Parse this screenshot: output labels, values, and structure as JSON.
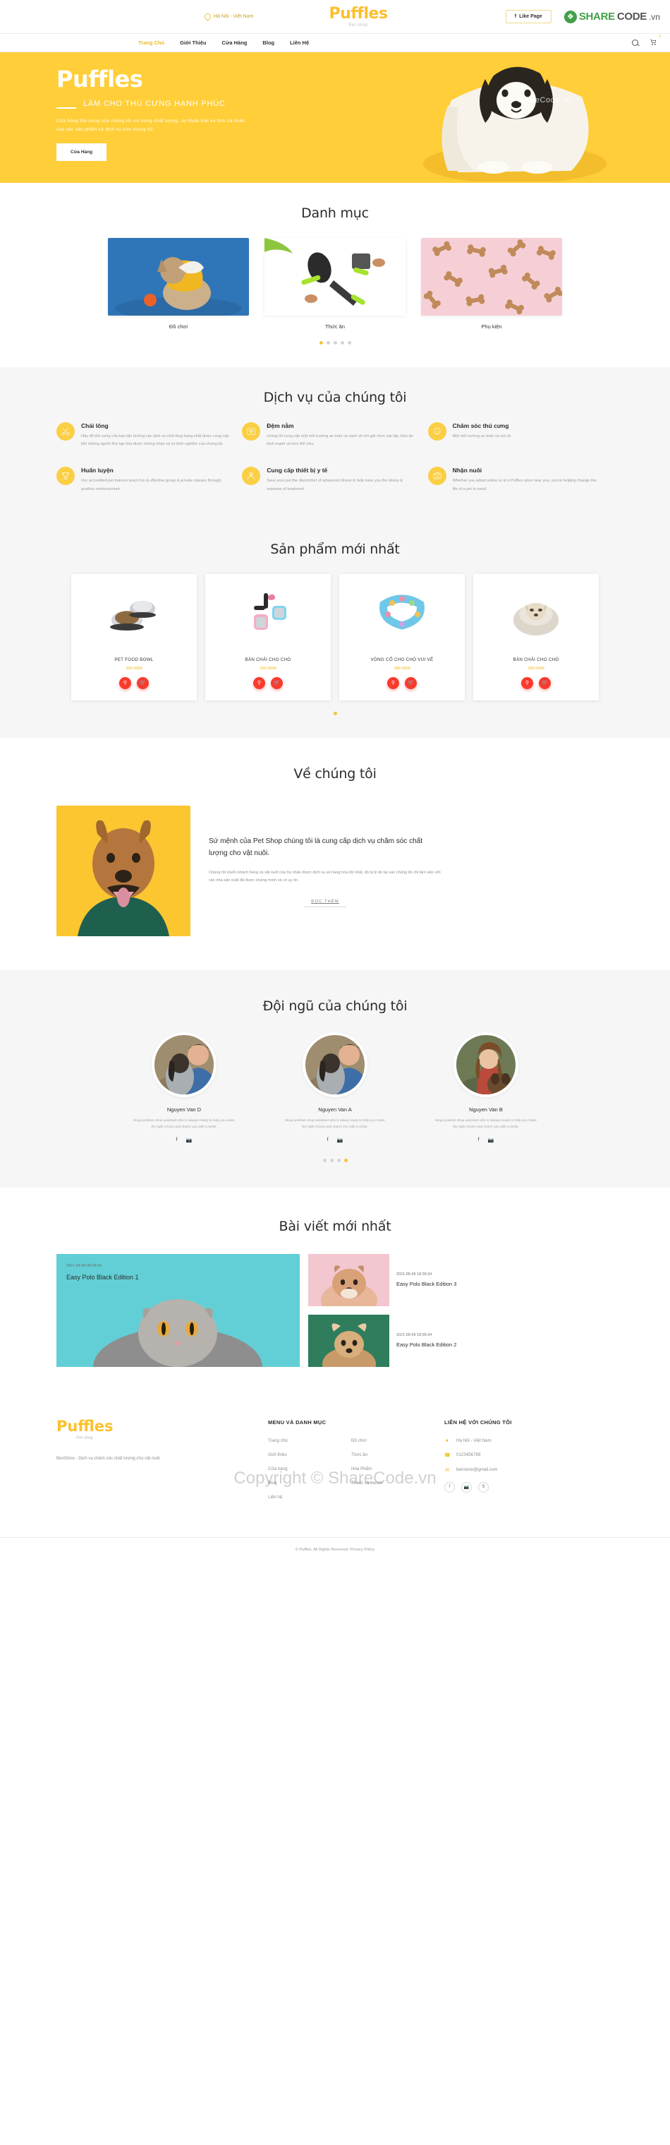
{
  "topbar": {
    "location": "Hà Nội - Việt Nam",
    "logo": "Puffles",
    "logo_sub": "Pet shop",
    "like_label": "Like Page",
    "like_icon": "facebook-icon",
    "watermark_leaf": "leaf-icon",
    "watermark_1": "SHARE",
    "watermark_2": "CODE",
    "watermark_3": ".vn"
  },
  "nav": {
    "items": [
      {
        "label": "Trang Chủ",
        "active": true
      },
      {
        "label": "Giới Thiệu",
        "active": false
      },
      {
        "label": "Cửa Hàng",
        "active": false
      },
      {
        "label": "Blog",
        "active": false
      },
      {
        "label": "Liên Hệ",
        "active": false
      }
    ],
    "search_icon": "search-icon",
    "cart_icon": "cart-icon",
    "cart_count": "0"
  },
  "hero": {
    "title": "Puffles",
    "subtitle": "LÀM CHO THÚ CƯNG HẠNH PHÚC",
    "body": "Cửa hàng thú cưng của chúng tôi coi trọng chất lượng, sự thoải mái và tính cá nhân cao các sản phẩm và dịch vụ của chúng tôi.",
    "button": "Cửa Hàng",
    "watermark": "ShareCode.vn",
    "bg_color": "#FFCE38"
  },
  "categories": {
    "title": "Danh mục",
    "items": [
      {
        "label": "Đồ chơi",
        "image": "puppy-in-yellow-hoodie-blue-bg"
      },
      {
        "label": "Thức ăn",
        "image": "green-pet-grooming-brushes"
      },
      {
        "label": "Phụ kiện",
        "image": "dog-bone-biscuits-pink-bg"
      }
    ],
    "dots": 5,
    "active_dot": 0
  },
  "services": {
    "title": "Dịch vụ của chúng tôi",
    "items": [
      {
        "icon": "scissors-icon",
        "title": "Chải lông",
        "text": "Hãy để thú cưng của bạn tận hưởng các dịch vụ chải lông hạng nhất được cung cấp bởi những người thợ tạp hóa được chứng nhận và có kinh nghiệm của chúng tôi."
      },
      {
        "icon": "pet-bed-icon",
        "title": "Đệm nằm",
        "text": "chúng tôi cung cấp một môi trường an toàn và sạch sẽ với giờ chơi, bài tập, bữa ăn lành mạnh và hơn thế nữa."
      },
      {
        "icon": "dog-face-icon",
        "title": "Chăm sóc thú cưng",
        "text": "Một môi trường an toàn và vui vẻ."
      },
      {
        "icon": "trophy-icon",
        "title": "Huấn luyện",
        "text": "Our accredited pet trainers teach fun & effective group & private classes through positive reinforcement."
      },
      {
        "icon": "vet-nurse-icon",
        "title": "Cung cấp thiết bị y tế",
        "text": "Save your pet the discomfort of advanced illness & help save you the stress & expense of treatment."
      },
      {
        "icon": "pet-crate-icon",
        "title": "Nhận nuôi",
        "text": "Whether you adopt online or at a Puffles store near you, you're helping change the life of a pet in need."
      }
    ]
  },
  "products": {
    "title": "Sản phẩm mới nhất",
    "view_icon": "search-icon",
    "cart_icon": "cart-icon",
    "items": [
      {
        "name": "PET FOOD BOWL",
        "price": "200.000đ",
        "image": "steel-pet-food-bowls"
      },
      {
        "name": "BÀN CHẢI CHO CHÓ",
        "price": "150.000đ",
        "image": "pink-blue-pet-brushes"
      },
      {
        "name": "VÒNG CỔ CHO CHÓ VUI VẺ",
        "price": "180.000đ",
        "image": "colorful-dog-collar"
      },
      {
        "name": "BÀN CHẢI CHO CHÓ",
        "price": "180.000đ",
        "image": "puppy-in-fluffy-bed"
      }
    ],
    "dots": 1,
    "active_dot": 0
  },
  "about": {
    "title": "Về chúng tôi",
    "image": "shouting-dog-green-jacket-yellow-bg",
    "heading": "Sứ mệnh của Pet Shop chúng tôi là cung cấp dịch vụ chăm sóc chất lượng cho vật nuôi.",
    "body": "Chúng tôi muốn khách hàng và vật nuôi của họ nhận được dịch vụ và hàng hóa tốt nhất, đó là lý do tại sao chúng tôi chỉ làm việc với các nhà sản xuất đã được chứng minh và có uy tín.",
    "read_more": "ĐỌC THÊM"
  },
  "team": {
    "title": "Đội ngũ của chúng tôi",
    "members": [
      {
        "name": "Nguyen Van D",
        "text": "Mega positive shop assistant who is always ready to help you make the right choice and charm you with a smile.",
        "image": "man-hugging-hound-dog",
        "facebook": "facebook-icon",
        "instagram": "instagram-icon"
      },
      {
        "name": "Nguyen Van A",
        "text": "Mega positive shop assistant who is alway ready to help you make the right choice and charm you with a smile.",
        "image": "man-hugging-hound-dog",
        "facebook": "facebook-icon",
        "instagram": "instagram-icon"
      },
      {
        "name": "Nguyen Van B",
        "text": "Mega positive shop assistant who is always ready to help you make the right choice and charm you with a smile.",
        "image": "woman-holding-puppy",
        "facebook": "facebook-icon",
        "instagram": "instagram-icon"
      }
    ],
    "dots": 4,
    "active_dot": 3
  },
  "blog": {
    "title": "Bài viết mới nhất",
    "featured": {
      "date": "2021-09-09 08:09:34",
      "title": "Easy Polo Black Edition 1",
      "image": "scottish-fold-cat-teal-bg"
    },
    "items": [
      {
        "date": "2021-09-09 18:00:34",
        "title": "Easy Polo Black Edition 3",
        "image": "shiba-inu-pink-bg"
      },
      {
        "date": "2021-09-09 18:00:34",
        "title": "Easy Polo Black Edition 2",
        "image": "chihuahua-green-bg"
      }
    ]
  },
  "footer": {
    "logo": "Puffles",
    "logo_sub": "Pet shop",
    "tagline": "BenStore - Dịch vụ chăm sóc chất lượng cho vật nuôi",
    "menu_heading": "MENU VÀ DANH MỤC",
    "menu_col1": [
      "Trang chủ",
      "Giới thiệu",
      "Cửa hàng",
      "Blog",
      "Liên hệ"
    ],
    "menu_col2": [
      "Đồ chơi",
      "Thức ăn",
      "Hóa Phẩm",
      "Thuốc và vacxin"
    ],
    "contact_heading": "LIÊN HỆ VỚI CHÚNG TÔI",
    "contact": [
      {
        "icon": "map-pin-icon",
        "value": "Hà Nội - Việt Nam"
      },
      {
        "icon": "phone-icon",
        "value": "0123456789"
      },
      {
        "icon": "envelope-icon",
        "value": "benstore@gmail.com"
      }
    ],
    "socials": [
      "facebook-icon",
      "instagram-icon",
      "skype-icon"
    ],
    "copyright": "©  Puffles. All Rights Reserved. Privacy Policy",
    "watermark": "Copyright © ShareCode.vn"
  }
}
